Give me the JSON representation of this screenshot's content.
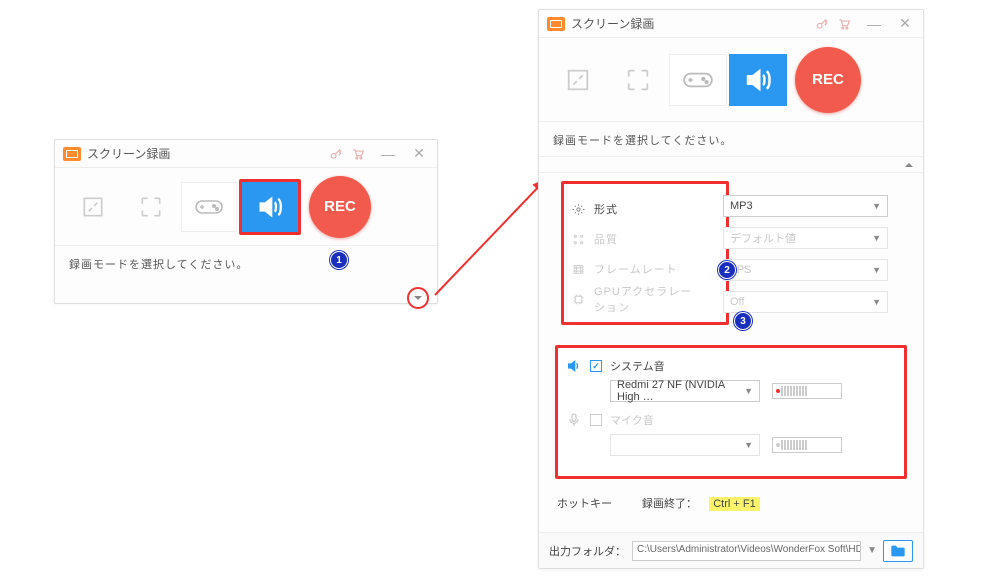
{
  "app": {
    "title": "スクリーン録画"
  },
  "instruction": "録画モードを選択してください。",
  "rec_label": "REC",
  "markers": {
    "one": "1",
    "two": "2",
    "three": "3"
  },
  "settings": {
    "format_label": "形式",
    "quality_label": "品質",
    "framerate_label": "フレームレート",
    "gpu_label": "GPUアクセラレーション",
    "format_value": "MP3",
    "quality_value": "デフォルト値",
    "framerate_value": "FPS",
    "gpu_value": "Off"
  },
  "audio": {
    "system_label": "システム音",
    "system_device": "Redmi 27 NF (NVIDIA High …",
    "mic_label": "マイク音"
  },
  "hotkey": {
    "title": "ホットキー",
    "stop_label": "録画終了：",
    "stop_key": "Ctrl + F1"
  },
  "output": {
    "label": "出力フォルダ：",
    "path": "C:\\Users\\Administrator\\Videos\\WonderFox Soft\\HD Vide"
  },
  "icons": {
    "logo": "logo-icon",
    "key": "key-icon",
    "cart": "cart-icon",
    "minimize": "minimize-icon",
    "close": "close-icon",
    "region": "region-icon",
    "fullscreen": "fullscreen-icon",
    "game": "game-icon",
    "audio": "audio-icon",
    "chevron_down": "chevron-down-icon",
    "chevron_up": "chevron-up-icon",
    "gear": "gear-icon",
    "sliders": "sliders-icon",
    "film": "film-icon",
    "chip": "chip-icon",
    "speaker": "speaker-icon",
    "mic": "mic-icon",
    "folder": "folder-icon"
  }
}
